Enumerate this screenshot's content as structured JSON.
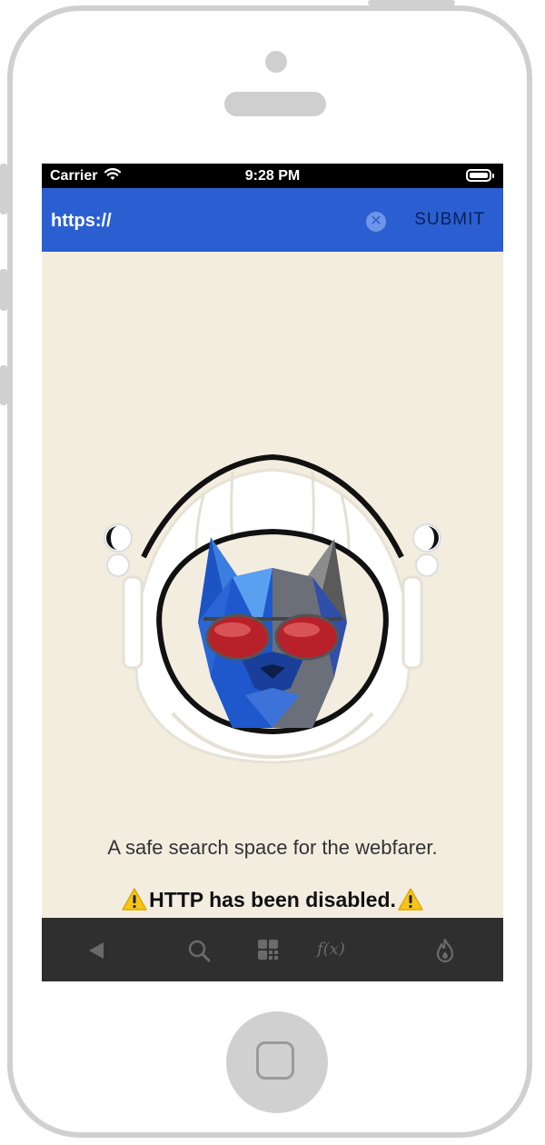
{
  "status_bar": {
    "carrier": "Carrier",
    "time": "9:28 PM",
    "wifi_icon": "wifi-icon",
    "battery_icon": "battery-icon"
  },
  "url_bar": {
    "url_value": "https://",
    "clear_icon": "clear-icon",
    "submit_label": "SUBMIT",
    "bar_color": "#2b5fd1"
  },
  "main": {
    "hero_image": "astronaut-dog-logo",
    "tagline": "A safe search space for the webfarer.",
    "warning_text": "HTTP has been disabled.",
    "warning_icon": "warning-icon",
    "background_color": "#f3ede0"
  },
  "toolbar": {
    "items": [
      {
        "icon": "back-icon"
      },
      {
        "icon": "search-icon"
      },
      {
        "icon": "grid-icon"
      },
      {
        "icon": "function-icon",
        "label": "f(x)"
      },
      {
        "icon": "flame-icon"
      }
    ]
  }
}
